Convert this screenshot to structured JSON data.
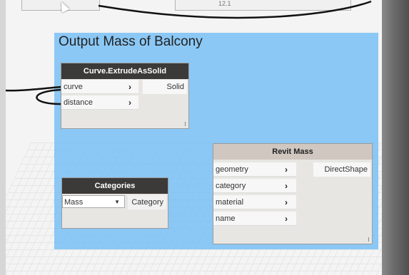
{
  "group": {
    "title": "Output Mass of Balcony",
    "color": "#7fc3f5"
  },
  "nodes": {
    "extrude": {
      "title": "Curve.ExtrudeAsSolid",
      "inputs": [
        "curve",
        "distance"
      ],
      "output": "Solid"
    },
    "categories": {
      "title": "Categories",
      "selected": "Mass",
      "output": "Category"
    },
    "revit_mass": {
      "title": "Revit Mass",
      "inputs": [
        "geometry",
        "category",
        "material",
        "name"
      ],
      "output": "DirectShape"
    },
    "top_node": {
      "value": "12.1"
    }
  },
  "icons": {
    "port_arrow": "chevron-right-icon",
    "dropdown": "triangle-down-icon",
    "cursor": "mouse-pointer-icon"
  }
}
